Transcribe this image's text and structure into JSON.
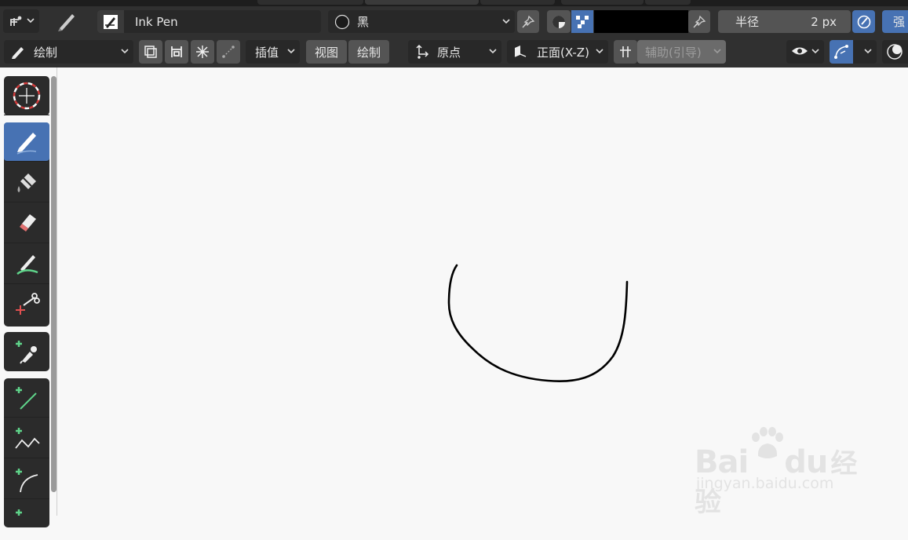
{
  "header": {
    "brush_name": "Ink Pen",
    "material": "黑",
    "radius_label": "半径",
    "radius_value": "2 px",
    "strength_label": "强"
  },
  "toolbar": {
    "mode": "绘制",
    "interpolate_label": "插值",
    "view_label": "视图",
    "draw_label": "绘制",
    "origin_label": "原点",
    "plane_label": "正面(X-Z)",
    "guides_label": "辅助(引导)"
  },
  "watermark": {
    "brand_latin_1": "Bai",
    "brand_latin_2": "du",
    "brand_cn": "经验",
    "url": "jingyan.baidu.com"
  },
  "colors": {
    "accent": "#4772b3",
    "panel": "#303030",
    "widget": "#282828",
    "canvas": "#f8f8f8",
    "stroke": "#000000"
  },
  "icons": [
    "snap-icon",
    "pen-icon",
    "brush-icon",
    "material-ball-icon",
    "pin-icon",
    "vertex-color-icon",
    "select-mode-icon",
    "eraser-icon",
    "multiframe-icon",
    "freeze-icon",
    "origin-icon",
    "plane-icon",
    "guides-icon",
    "overlay-eye-icon",
    "gizmo-icon",
    "shading-icon",
    "cursor-tool-icon",
    "draw-tool-icon",
    "fill-tool-icon",
    "erase-tool-icon",
    "tint-tool-icon",
    "cutter-tool-icon",
    "eyedropper-tool-icon",
    "line-tool-icon",
    "polyline-tool-icon",
    "arc-tool-icon"
  ]
}
